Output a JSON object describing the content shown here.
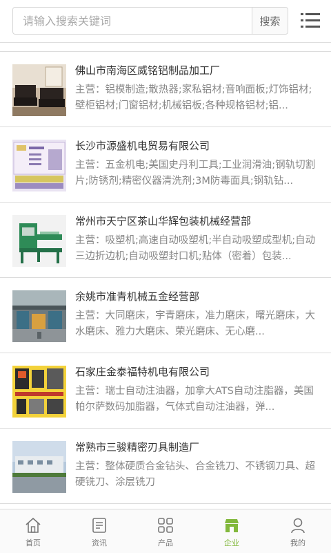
{
  "search": {
    "placeholder": "请输入搜索关键词",
    "button_label": "搜索"
  },
  "companies": [
    {
      "name": "佛山市南海区威铭铝制品加工厂",
      "main_business": "主营：铝模制造;散热器;家私铝材;音响面板;灯饰铝材;壁柜铝材;门窗铝材;机械铝板;各种规格铝材;铝..."
    },
    {
      "name": "长沙市源盛机电贸易有限公司",
      "main_business": "主营：五金机电;美国史丹利工具;工业润滑油;钢轨切割片;防锈剂;精密仪器清洗剂;3M防毒面具;钢轨钻..."
    },
    {
      "name": "常州市天宁区茶山华辉包装机械经营部",
      "main_business": "主营：吸塑机;高速自动吸塑机;半自动吸塑成型机;自动三边折边机;自动吸塑封口机;贴体（密着）包装..."
    },
    {
      "name": "余姚市准青机械五金经营部",
      "main_business": "主营：大同磨床，宇青磨床，准力磨床，曙光磨床，大水磨床、雅力大磨床、荣光磨床、无心磨..."
    },
    {
      "name": "石家庄金泰福特机电有限公司",
      "main_business": "主营：瑞士自动注油器，加拿大ATS自动注脂器，美国帕尔萨数码加脂器，气体式自动注油器，弹..."
    },
    {
      "name": "常熟市三骏精密刃具制造厂",
      "main_business": "主营：整体硬质合金钻头、合金铣刀、不锈钢刀具、超硬铣刀、涂层铣刀"
    }
  ],
  "tabs": [
    {
      "label": "首页",
      "icon": "home-icon"
    },
    {
      "label": "资讯",
      "icon": "news-icon"
    },
    {
      "label": "产品",
      "icon": "products-icon"
    },
    {
      "label": "企业",
      "icon": "company-icon",
      "active": true
    },
    {
      "label": "我的",
      "icon": "user-icon"
    }
  ],
  "colors": {
    "accent": "#82b83c",
    "text": "#333333",
    "muted": "#888888",
    "border": "#dcdcdc"
  }
}
